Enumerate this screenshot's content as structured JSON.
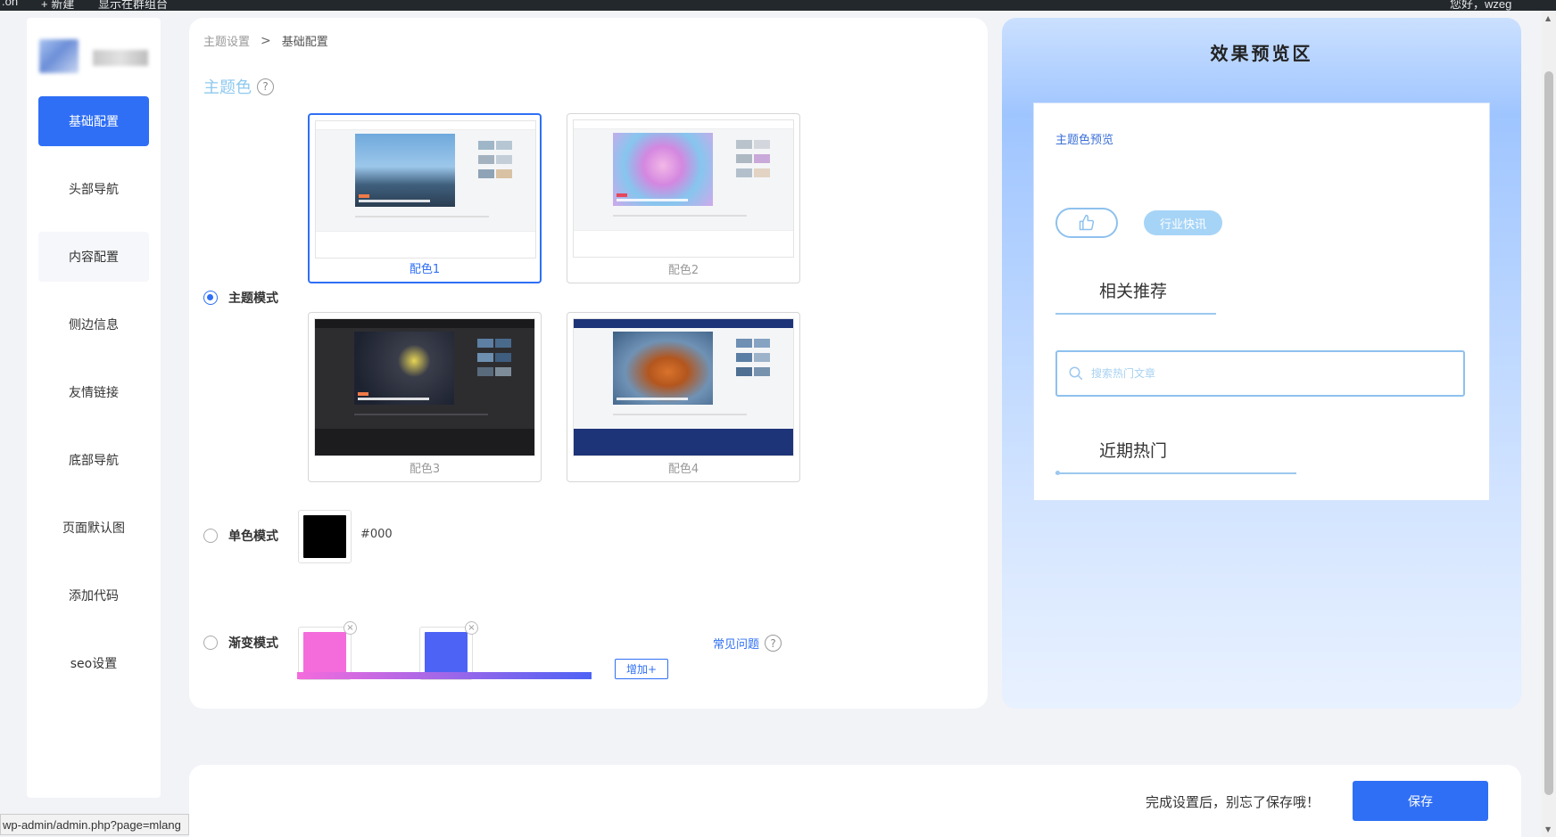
{
  "adminbar": {
    "left_items": [
      ".on",
      "+ 新建",
      "显示在群组台"
    ],
    "right_text": "您好，wzeg"
  },
  "sidebar": {
    "items": [
      {
        "label": "基础配置",
        "state": "active"
      },
      {
        "label": "头部导航",
        "state": "normal"
      },
      {
        "label": "内容配置",
        "state": "hover"
      },
      {
        "label": "侧边信息",
        "state": "normal"
      },
      {
        "label": "友情链接",
        "state": "normal"
      },
      {
        "label": "底部导航",
        "state": "normal"
      },
      {
        "label": "页面默认图",
        "state": "normal"
      },
      {
        "label": "添加代码",
        "state": "normal"
      },
      {
        "label": "seo设置",
        "state": "normal"
      }
    ]
  },
  "main": {
    "breadcrumb": {
      "parent": "主题设置",
      "separator": ">",
      "current": "基础配置"
    },
    "section_title": "主题色",
    "help_glyph": "?",
    "theme_mode": {
      "label": "主题模式",
      "selected": true,
      "options": [
        {
          "caption": "配色1",
          "selected": true
        },
        {
          "caption": "配色2",
          "selected": false
        },
        {
          "caption": "配色3",
          "selected": false
        },
        {
          "caption": "配色4",
          "selected": false
        }
      ]
    },
    "solid_mode": {
      "label": "单色模式",
      "selected": false,
      "color": "#000000",
      "hex_text": "#000"
    },
    "gradient_mode": {
      "label": "渐变模式",
      "selected": false,
      "colors": [
        "#f46bdc",
        "#4d63f5"
      ],
      "close_glyph": "×",
      "add_button": "增加+",
      "faq_link": "常见问题"
    }
  },
  "preview": {
    "title": "效果预览区",
    "theme_color_preview": "主题色预览",
    "chip": "行业快讯",
    "related_heading": "相关推荐",
    "search_placeholder": "搜索热门文章",
    "hot_heading": "近期热门"
  },
  "footer": {
    "tip": "完成设置后，别忘了保存哦！",
    "save_button": "保存"
  },
  "status_url": "wp-admin/admin.php?page=mlang",
  "colors": {
    "accent": "#2f6ff5",
    "light_blue": "#9cc8ee",
    "preview_gradient_top": "#9fc5ff"
  }
}
